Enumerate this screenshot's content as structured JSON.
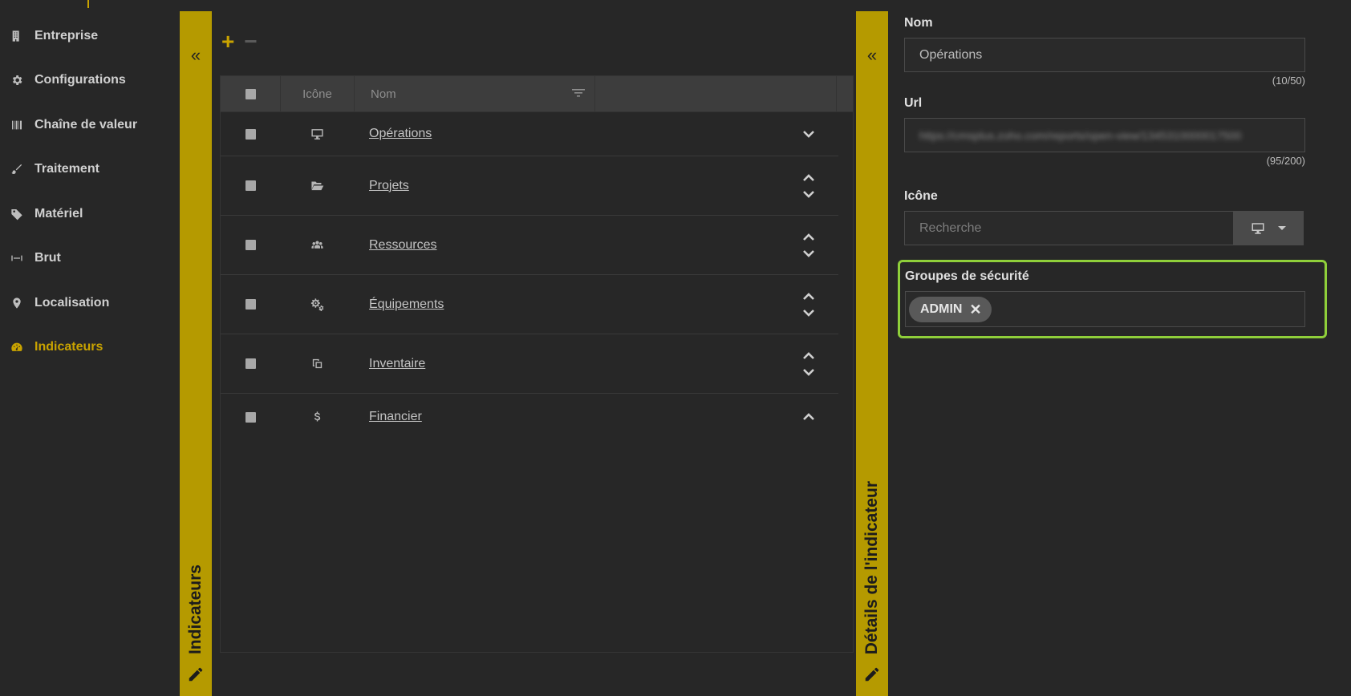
{
  "nav": {
    "items": [
      {
        "label": "Entreprise",
        "icon": "building-icon",
        "active": false
      },
      {
        "label": "Configurations",
        "icon": "gear-icon",
        "active": false
      },
      {
        "label": "Chaîne de valeur",
        "icon": "barcode-icon",
        "active": false
      },
      {
        "label": "Traitement",
        "icon": "brush-icon",
        "active": false
      },
      {
        "label": "Matériel",
        "icon": "tag-icon",
        "active": false
      },
      {
        "label": "Brut",
        "icon": "arrows-h-icon",
        "active": false
      },
      {
        "label": "Localisation",
        "icon": "map-marker-icon",
        "active": false
      },
      {
        "label": "Indicateurs",
        "icon": "dashboard-icon",
        "active": true
      }
    ]
  },
  "panels": {
    "left_title": "Indicateurs",
    "right_title": "Détails de l'indicateur",
    "collapse_glyph": "«"
  },
  "toolbar": {
    "add": "+",
    "remove": "−"
  },
  "grid": {
    "headers": {
      "icon": "Icône",
      "name": "Nom"
    },
    "rows": [
      {
        "name": "Opérations",
        "icon": "desktop-icon",
        "up": false,
        "down": true
      },
      {
        "name": "Projets",
        "icon": "folder-open-icon",
        "up": true,
        "down": true
      },
      {
        "name": "Ressources",
        "icon": "users-icon",
        "up": true,
        "down": true
      },
      {
        "name": "Équipements",
        "icon": "cogs-icon",
        "up": true,
        "down": true
      },
      {
        "name": "Inventaire",
        "icon": "copy-icon",
        "up": true,
        "down": true
      },
      {
        "name": "Financier",
        "icon": "dollar-icon",
        "up": true,
        "down": false
      }
    ]
  },
  "form": {
    "nom_label": "Nom",
    "nom_value": "Opérations",
    "nom_counter": "(10/50)",
    "url_label": "Url",
    "url_value": "https://cmsplus.zoho.com/reports/open-view/1345310000017500",
    "url_counter": "(95/200)",
    "icone_label": "Icône",
    "icone_placeholder": "Recherche",
    "icone_selected": "desktop-icon",
    "security_label": "Groupes de sécurité",
    "security_tags": [
      "ADMIN"
    ]
  },
  "colors": {
    "accent": "#c9a300",
    "panel_bar": "#b59a00",
    "highlight": "#8fcf3a",
    "background": "#272727"
  }
}
